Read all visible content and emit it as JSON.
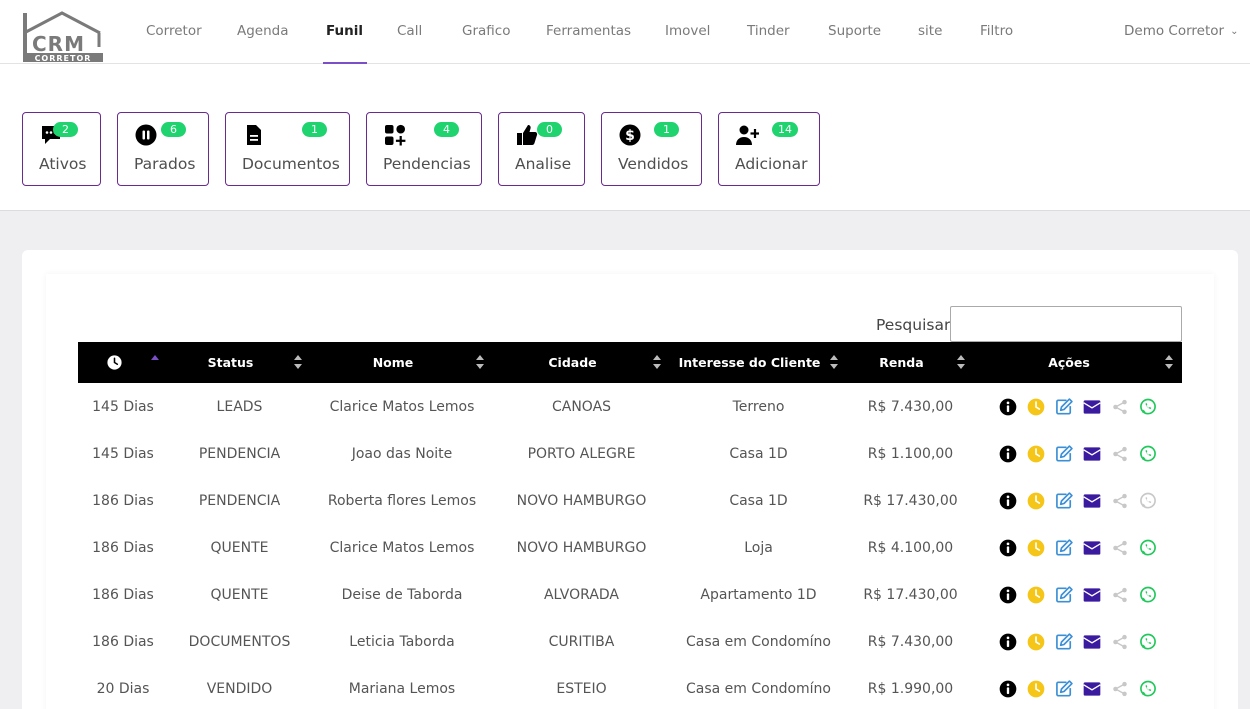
{
  "brand": {
    "logo_top": "CRM",
    "logo_bottom": "CORRETOR"
  },
  "nav": {
    "items": [
      "Corretor",
      "Agenda",
      "Funil",
      "Call",
      "Grafico",
      "Ferramentas",
      "Imovel",
      "Tinder",
      "Suporte",
      "site",
      "Filtro"
    ],
    "active": "Funil",
    "user": "Demo Corretor"
  },
  "stages": [
    {
      "label": "Ativos",
      "count": "2",
      "icon": "comment-dots-icon"
    },
    {
      "label": "Parados",
      "count": "6",
      "icon": "pause-circle-icon"
    },
    {
      "label": "Documentos",
      "count": "1",
      "icon": "file-icon"
    },
    {
      "label": "Pendencias",
      "count": "4",
      "icon": "shapes-plus-icon"
    },
    {
      "label": "Analise",
      "count": "0",
      "icon": "thumbs-up-icon"
    },
    {
      "label": "Vendidos",
      "count": "1",
      "icon": "dollar-circle-icon"
    },
    {
      "label": "Adicionar",
      "count": "14",
      "icon": "user-plus-icon"
    }
  ],
  "search": {
    "label": "Pesquisar",
    "value": ""
  },
  "table": {
    "columns": [
      "",
      "Status",
      "Nome",
      "Cidade",
      "Interesse do Cliente",
      "Renda",
      "Ações"
    ],
    "first_column_icon": "clock-icon",
    "sorted_column": 0,
    "rows": [
      {
        "dias": "145 Dias",
        "status": "LEADS",
        "nome": "Clarice Matos Lemos",
        "cidade": "CANOAS",
        "interesse": "Terreno",
        "renda": "R$ 7.430,00",
        "whatsapp_active": true
      },
      {
        "dias": "145 Dias",
        "status": "PENDENCIA",
        "nome": "Joao das Noite",
        "cidade": "PORTO ALEGRE",
        "interesse": "Casa 1D",
        "renda": "R$ 1.100,00",
        "whatsapp_active": true
      },
      {
        "dias": "186 Dias",
        "status": "PENDENCIA",
        "nome": "Roberta flores Lemos",
        "cidade": "NOVO HAMBURGO",
        "interesse": "Casa 1D",
        "renda": "R$ 17.430,00",
        "whatsapp_active": false
      },
      {
        "dias": "186 Dias",
        "status": "QUENTE",
        "nome": "Clarice Matos Lemos",
        "cidade": "NOVO HAMBURGO",
        "interesse": "Loja",
        "renda": "R$ 4.100,00",
        "whatsapp_active": true
      },
      {
        "dias": "186 Dias",
        "status": "QUENTE",
        "nome": "Deise de Taborda",
        "cidade": "ALVORADA",
        "interesse": "Apartamento 1D",
        "renda": "R$ 17.430,00",
        "whatsapp_active": true
      },
      {
        "dias": "186 Dias",
        "status": "DOCUMENTOS",
        "nome": "Leticia Taborda",
        "cidade": "CURITIBA",
        "interesse": "Casa em Condomíno",
        "renda": "R$ 7.430,00",
        "whatsapp_active": true
      },
      {
        "dias": "20 Dias",
        "status": "VENDIDO",
        "nome": "Mariana Lemos",
        "cidade": "ESTEIO",
        "interesse": "Casa em Condomíno",
        "renda": "R$ 1.990,00",
        "whatsapp_active": true
      }
    ],
    "actions": [
      "info-icon",
      "clock-icon",
      "edit-icon",
      "envelope-icon",
      "share-icon",
      "whatsapp-icon"
    ]
  },
  "colors": {
    "accent": "#7b4fc8",
    "stage_border": "#6a2a8e",
    "badge": "#1fd36e",
    "clock_icon": "#f5c518",
    "edit_icon": "#3b8fd6",
    "envelope_icon": "#3a1a9e",
    "whatsapp_active": "#1fc85a",
    "whatsapp_inactive": "#c8c8c8"
  }
}
